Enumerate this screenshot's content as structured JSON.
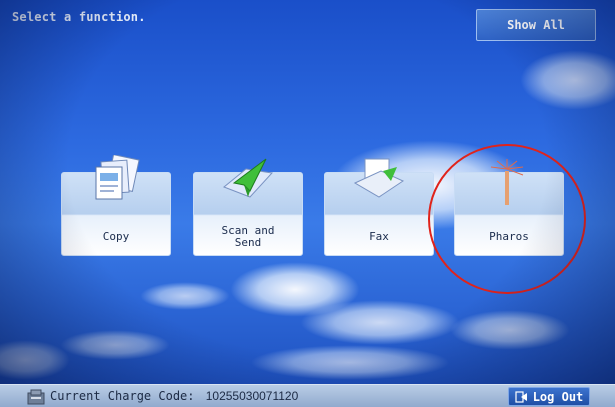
{
  "header": {
    "prompt": "Select a function.",
    "show_all_label": "Show All"
  },
  "functions": [
    {
      "label": "Copy",
      "icon": "copy-icon"
    },
    {
      "label": "Scan and\nSend",
      "icon": "scan-and-send-icon"
    },
    {
      "label": "Fax",
      "icon": "fax-icon"
    },
    {
      "label": "Pharos",
      "icon": "pharos-icon"
    }
  ],
  "status_bar": {
    "charge_label": "Current Charge Code:",
    "charge_code": "10255030071120",
    "logout_label": "Log Out"
  },
  "colors": {
    "background": "#2d6ae0",
    "annotation": "#e0231b",
    "button": "#2e62c4"
  }
}
